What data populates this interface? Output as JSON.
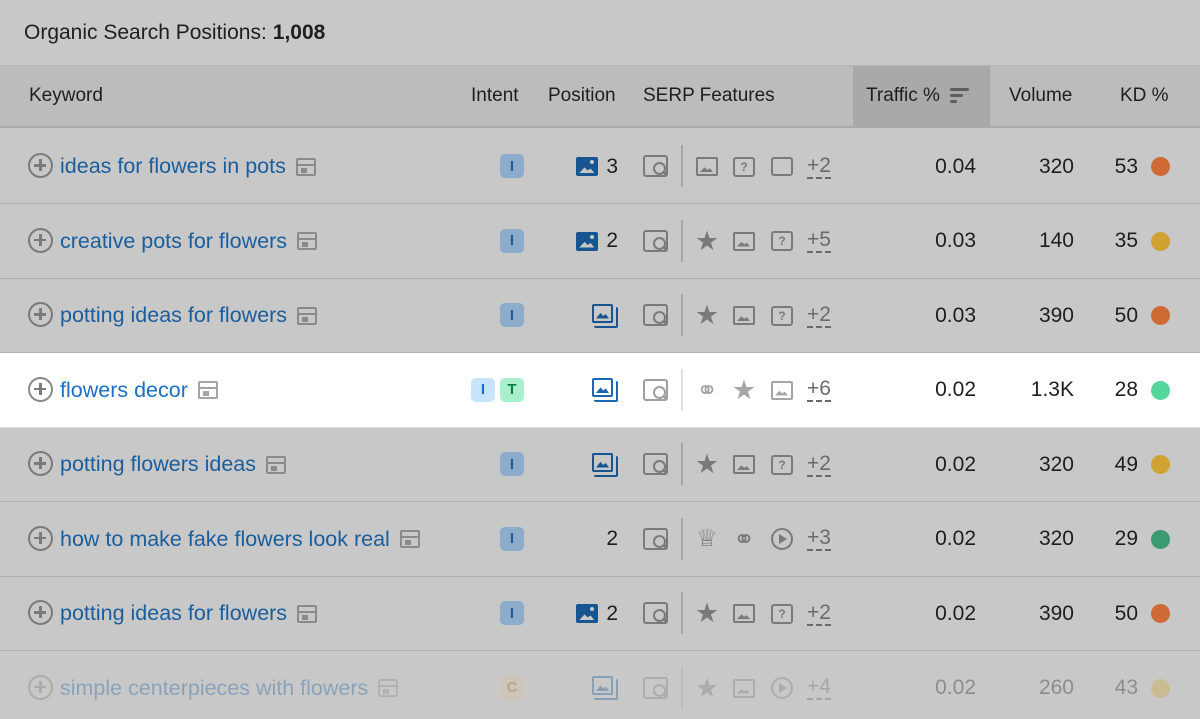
{
  "title": {
    "label": "Organic Search Positions:",
    "count": "1,008"
  },
  "columns": {
    "keyword": "Keyword",
    "intent": "Intent",
    "position": "Position",
    "serp": "SERP Features",
    "traffic": "Traffic %",
    "volume": "Volume",
    "kd": "KD %"
  },
  "colors": {
    "kd_orange": "#d06a34",
    "kd_yellow": "#cfa232",
    "kd_green_highlight": "#55d69a",
    "kd_green": "#3a9b70",
    "link": "#1a5e9e"
  },
  "rows": [
    {
      "keyword": "ideas for flowers in pots",
      "intents": [
        "I"
      ],
      "position": "3",
      "position_icon": "image-icon",
      "features": [
        "image-icon",
        "faq-icon",
        "bubble-icon"
      ],
      "more": "+2",
      "traffic": "0.04",
      "volume": "320",
      "kd": "53",
      "kd_color": "#d06a34"
    },
    {
      "keyword": "creative pots for flowers",
      "intents": [
        "I"
      ],
      "position": "2",
      "position_icon": "image-icon",
      "features": [
        "star-icon",
        "image-icon",
        "faq-icon"
      ],
      "more": "+5",
      "traffic": "0.03",
      "volume": "140",
      "kd": "35",
      "kd_color": "#cfa232"
    },
    {
      "keyword": "potting ideas for flowers",
      "intents": [
        "I"
      ],
      "position": "",
      "position_icon": "image-pack-icon",
      "features": [
        "star-icon",
        "image-icon",
        "faq-icon"
      ],
      "more": "+2",
      "traffic": "0.03",
      "volume": "390",
      "kd": "50",
      "kd_color": "#d06a34"
    },
    {
      "keyword": "flowers decor",
      "intents": [
        "I",
        "T"
      ],
      "position": "",
      "position_icon": "image-pack-icon",
      "features": [
        "link-icon",
        "star-icon",
        "image-icon"
      ],
      "more": "+6",
      "traffic": "0.02",
      "volume": "1.3K",
      "kd": "28",
      "kd_color": "#55d69a",
      "highlight": true
    },
    {
      "keyword": "potting flowers ideas",
      "intents": [
        "I"
      ],
      "position": "",
      "position_icon": "image-pack-icon",
      "features": [
        "star-icon",
        "image-icon",
        "faq-icon"
      ],
      "more": "+2",
      "traffic": "0.02",
      "volume": "320",
      "kd": "49",
      "kd_color": "#cfa232"
    },
    {
      "keyword": "how to make fake flowers look real",
      "intents": [
        "I"
      ],
      "position": "2",
      "position_icon": "",
      "features": [
        "crown-icon",
        "link-icon",
        "video-icon"
      ],
      "more": "+3",
      "traffic": "0.02",
      "volume": "320",
      "kd": "29",
      "kd_color": "#3a9b70"
    },
    {
      "keyword": "potting ideas for flowers",
      "intents": [
        "I"
      ],
      "position": "2",
      "position_icon": "image-icon",
      "features": [
        "star-icon",
        "image-icon",
        "faq-icon"
      ],
      "more": "+2",
      "traffic": "0.02",
      "volume": "390",
      "kd": "50",
      "kd_color": "#d06a34"
    },
    {
      "keyword": "simple centerpieces with flowers",
      "intents": [
        "C"
      ],
      "position": "",
      "position_icon": "image-pack-icon",
      "features": [
        "star-icon",
        "image-icon",
        "video-icon"
      ],
      "more": "+4",
      "traffic": "0.02",
      "volume": "260",
      "kd": "43",
      "kd_color": "#cfa232",
      "faded": true
    }
  ]
}
